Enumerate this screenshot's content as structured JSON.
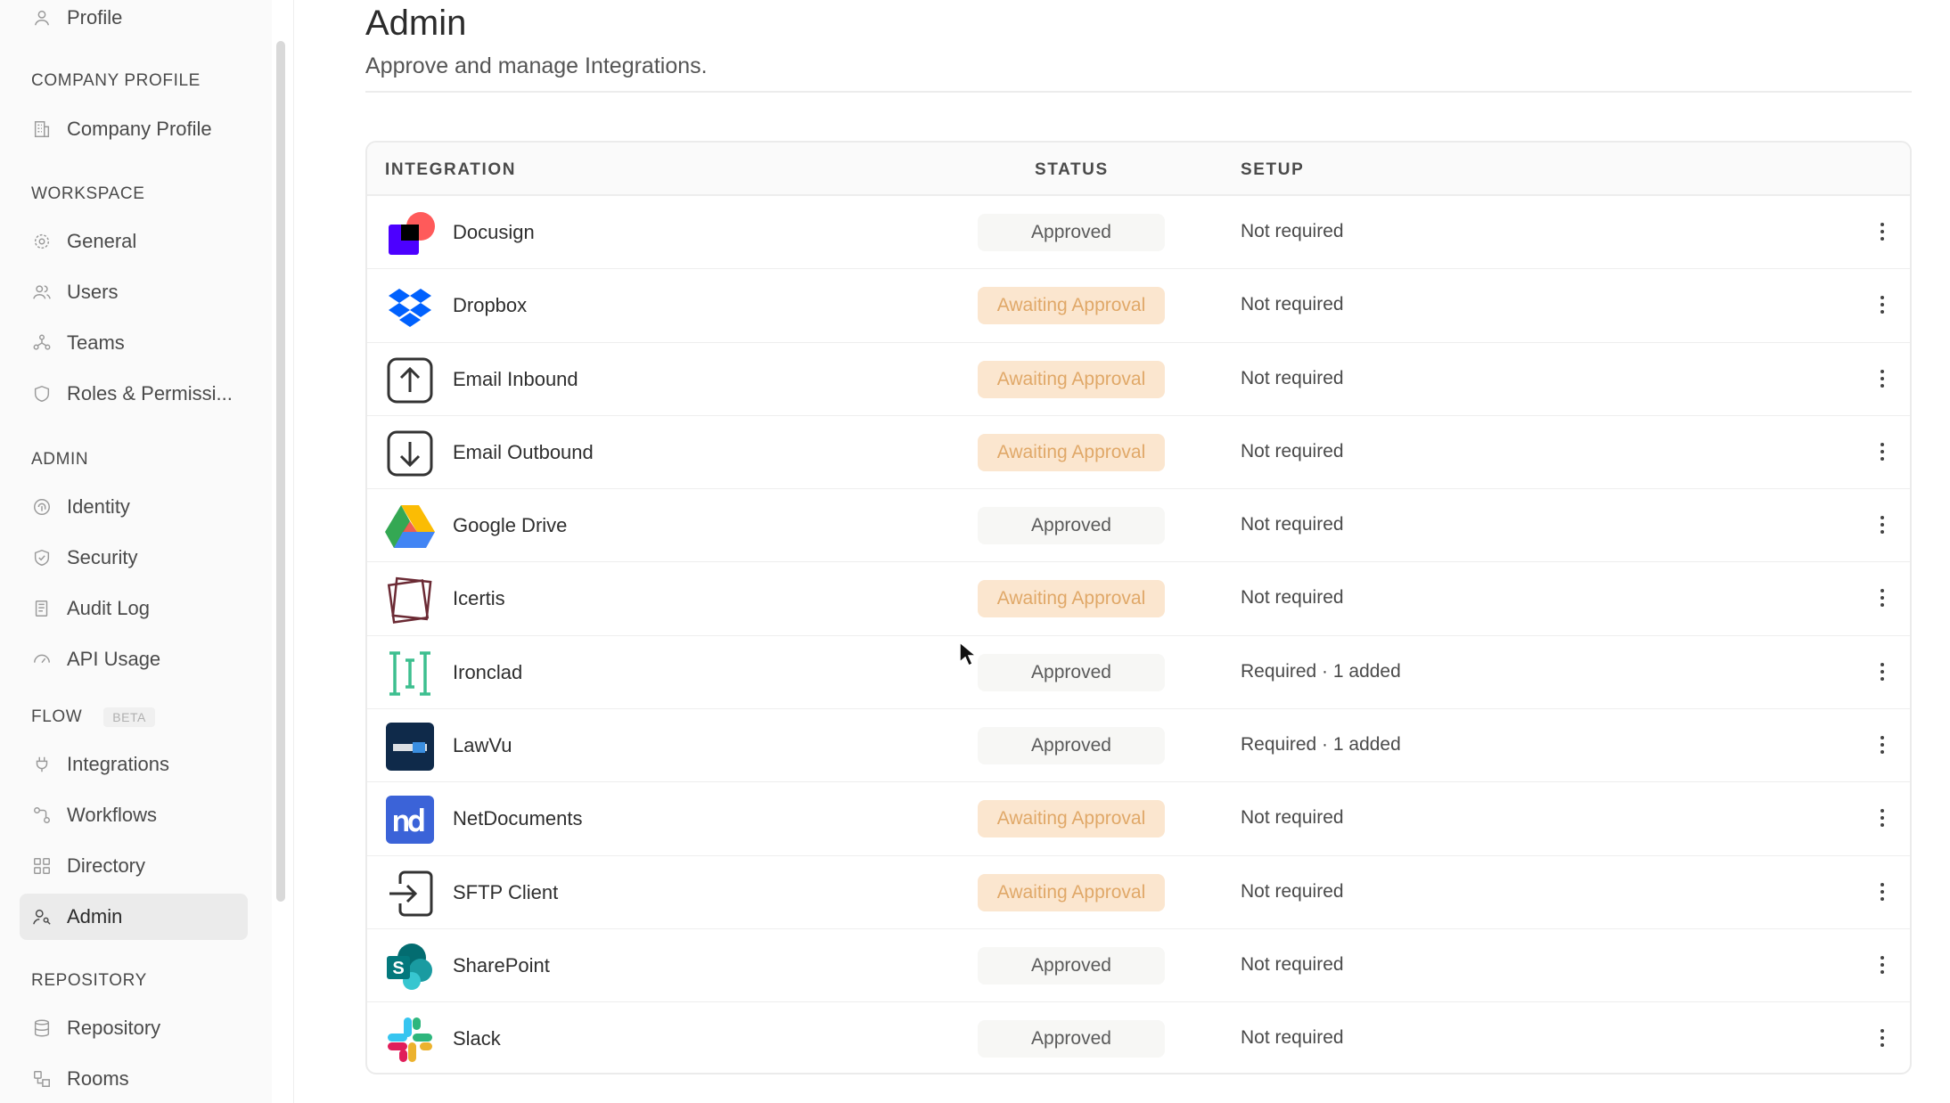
{
  "sidebar": {
    "profile": "Profile",
    "sections": {
      "company_profile": "COMPANY PROFILE",
      "workspace": "WORKSPACE",
      "admin": "ADMIN",
      "flow": "FLOW",
      "flow_badge": "BETA",
      "repository": "REPOSITORY"
    },
    "items": {
      "company_profile": "Company Profile",
      "general": "General",
      "users": "Users",
      "teams": "Teams",
      "roles": "Roles & Permissi...",
      "identity": "Identity",
      "security": "Security",
      "audit_log": "Audit Log",
      "api_usage": "API Usage",
      "integrations": "Integrations",
      "workflows": "Workflows",
      "directory": "Directory",
      "admin": "Admin",
      "repository": "Repository",
      "rooms": "Rooms"
    }
  },
  "header": {
    "title": "Admin",
    "subtitle": "Approve and manage Integrations."
  },
  "table": {
    "columns": {
      "integration": "INTEGRATION",
      "status": "STATUS",
      "setup": "SETUP"
    },
    "rows": [
      {
        "name": "Docusign",
        "status": "Approved",
        "setup": "Not required",
        "icon": "docusign-logo-icon"
      },
      {
        "name": "Dropbox",
        "status": "Awaiting Approval",
        "setup": "Not required",
        "icon": "dropbox-logo-icon"
      },
      {
        "name": "Email Inbound",
        "status": "Awaiting Approval",
        "setup": "Not required",
        "icon": "arrow-up-box-icon"
      },
      {
        "name": "Email Outbound",
        "status": "Awaiting Approval",
        "setup": "Not required",
        "icon": "arrow-down-box-icon"
      },
      {
        "name": "Google Drive",
        "status": "Approved",
        "setup": "Not required",
        "icon": "google-drive-logo-icon"
      },
      {
        "name": "Icertis",
        "status": "Awaiting Approval",
        "setup": "Not required",
        "icon": "icertis-logo-icon"
      },
      {
        "name": "Ironclad",
        "status": "Approved",
        "setup": "Required · 1 added",
        "icon": "ironclad-logo-icon"
      },
      {
        "name": "LawVu",
        "status": "Approved",
        "setup": "Required · 1 added",
        "icon": "lawvu-logo-icon"
      },
      {
        "name": "NetDocuments",
        "status": "Awaiting Approval",
        "setup": "Not required",
        "icon": "netdocuments-logo-icon"
      },
      {
        "name": "SFTP Client",
        "status": "Awaiting Approval",
        "setup": "Not required",
        "icon": "sign-in-arrow-icon"
      },
      {
        "name": "SharePoint",
        "status": "Approved",
        "setup": "Not required",
        "icon": "sharepoint-logo-icon"
      },
      {
        "name": "Slack",
        "status": "Approved",
        "setup": "Not required",
        "icon": "slack-logo-icon"
      }
    ]
  },
  "colors": {
    "approved_bg": "#f7f7f5",
    "awaiting_bg": "#fbe6cf",
    "awaiting_text": "#e0a868",
    "active_nav_bg": "#ebebeb"
  }
}
